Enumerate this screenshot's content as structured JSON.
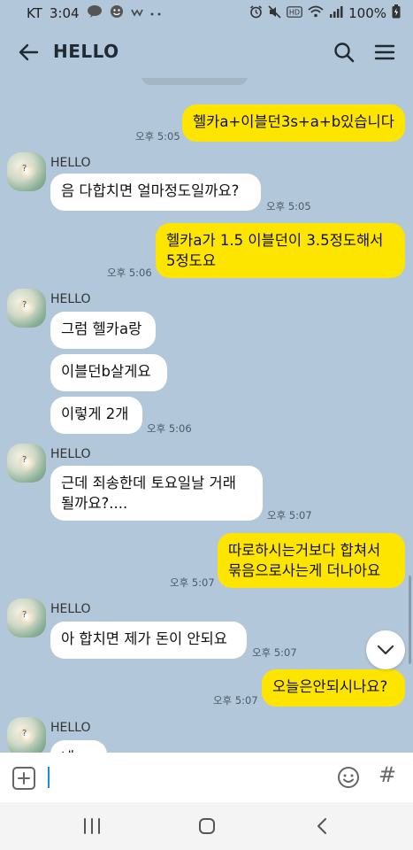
{
  "status_bar": {
    "carrier": "KT",
    "time": "3:04",
    "battery": "100%",
    "icons": [
      "talk-icon",
      "smiley-icon",
      "w-icon",
      "more-dots-icon",
      "alarm-icon",
      "mute-icon",
      "hd-icon",
      "wifi-icon",
      "signal-icon",
      "battery-icon"
    ]
  },
  "header": {
    "title": "HELLO",
    "back_icon": "arrow-left-icon",
    "search_icon": "search-icon",
    "menu_icon": "hamburger-icon"
  },
  "messages": [
    {
      "from": "me",
      "lines": [
        "헬카a+이블던3s+a+b있습니다"
      ],
      "time": "오후 5:05"
    },
    {
      "from": "them",
      "sender": "HELLO",
      "lines": [
        "음 다합치면 얼마정도일까요?"
      ],
      "time": "오후 5:05"
    },
    {
      "from": "me",
      "lines": [
        "헬카a가 1.5 이블던이 3.5정도해서",
        "5정도요"
      ],
      "time": "오후 5:06"
    },
    {
      "from": "them",
      "sender": "HELLO",
      "lines": [
        "그럼 헬카a랑"
      ]
    },
    {
      "from": "them",
      "lines": [
        "이블던b살게요"
      ]
    },
    {
      "from": "them",
      "lines": [
        "이렇게 2개"
      ],
      "time": "오후 5:06"
    },
    {
      "from": "them",
      "sender": "HELLO",
      "lines": [
        "근데 죄송한데 토요일날 거래",
        "될까요?...."
      ],
      "time": "오후 5:07"
    },
    {
      "from": "me",
      "lines": [
        "따로하시는거보다 합쳐서",
        "묶음으로사는게 더나아요"
      ],
      "time": "오후 5:07"
    },
    {
      "from": "them",
      "sender": "HELLO",
      "lines": [
        "아 합치면 제가 돈이 안되요"
      ],
      "time": "오후 5:07"
    },
    {
      "from": "me",
      "lines": [
        "오늘은안되시나요?"
      ],
      "time": "오후 5:07"
    },
    {
      "from": "them",
      "sender": "HELLO",
      "lines": [
        "네"
      ]
    }
  ],
  "input": {
    "value": "",
    "plus_icon": "plus-square-icon",
    "emoji_icon": "emoji-icon",
    "hash_label": "#"
  },
  "scroll_down_icon": "chevron-down-icon",
  "nav_bar": {
    "icons": [
      "recent-apps-icon",
      "home-icon",
      "back-icon"
    ]
  },
  "colors": {
    "chat_background": "#b2c7d9",
    "my_bubble": "#fee500",
    "their_bubble": "#ffffff"
  }
}
